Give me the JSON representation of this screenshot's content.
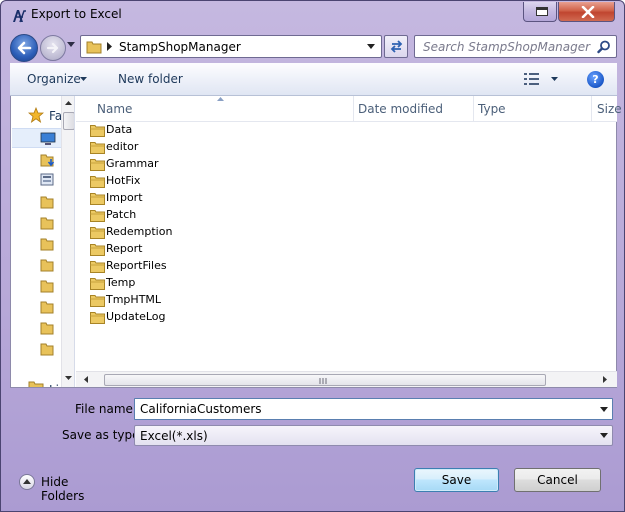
{
  "window": {
    "title": "Export to Excel"
  },
  "nav": {
    "address_path": "StampShopManager",
    "search_placeholder": "Search StampShopManager"
  },
  "toolbar": {
    "organize_label": "Organize",
    "new_folder_label": "New folder"
  },
  "nav_pane": {
    "favorites_label": "Fa",
    "libraries_label": "Li"
  },
  "columns": {
    "name": "Name",
    "date_modified": "Date modified",
    "type": "Type",
    "size": "Size"
  },
  "files": [
    "Data",
    "editor",
    "Grammar",
    "HotFix",
    "Import",
    "Patch",
    "Redemption",
    "Report",
    "ReportFiles",
    "Temp",
    "TmpHTML",
    "UpdateLog"
  ],
  "form": {
    "file_name_label": "File name:",
    "file_name_value": "CaliforniaCustomers",
    "save_as_type_label": "Save as type:",
    "save_as_type_value": "Excel(*.xls)"
  },
  "footer": {
    "hide_folders_label": "Hide Folders",
    "save_label": "Save",
    "cancel_label": "Cancel"
  },
  "colors": {
    "frame": "#b7a8d8",
    "accent": "#3c7fb1",
    "folder": "#e8c25a"
  }
}
